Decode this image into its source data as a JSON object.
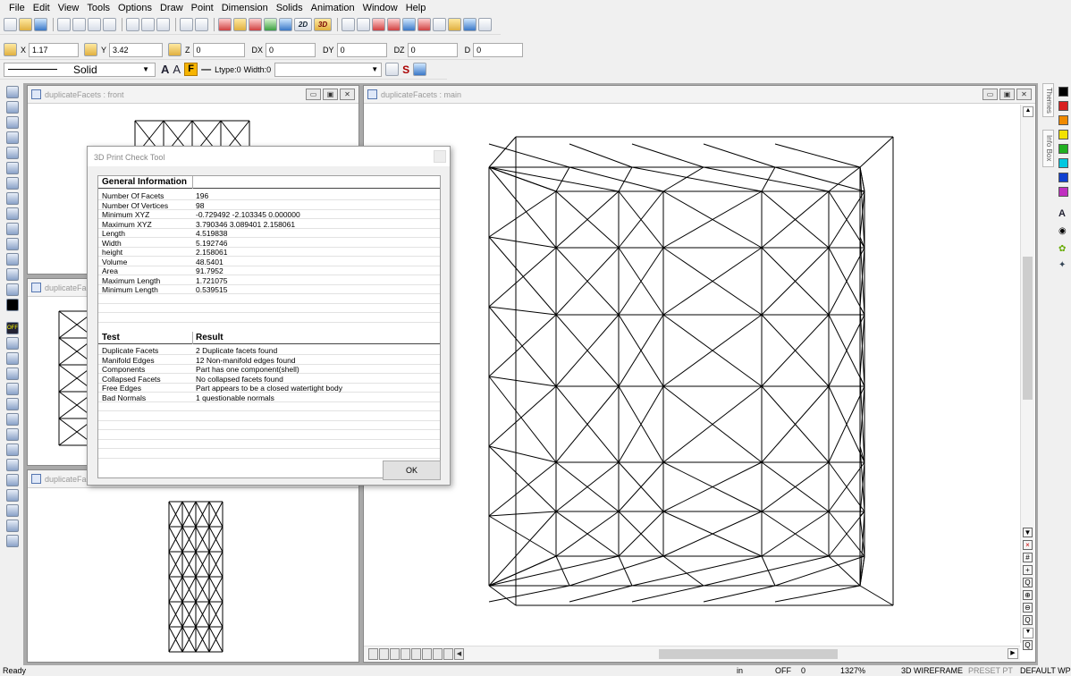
{
  "menu": [
    "File",
    "Edit",
    "View",
    "Tools",
    "Options",
    "Draw",
    "Point",
    "Dimension",
    "Solids",
    "Animation",
    "Window",
    "Help"
  ],
  "coords": {
    "x_label": "X",
    "x": "1.17",
    "y_label": "Y",
    "y": "3.42",
    "z_label": "Z",
    "z": "0",
    "dx_label": "DX",
    "dx": "0",
    "dy_label": "DY",
    "dy": "0",
    "dz_label": "DZ",
    "dz": "0",
    "d_label": "D",
    "d": "0"
  },
  "linebar": {
    "style": "Solid",
    "font_a1": "A",
    "font_a2": "A",
    "fill": "F",
    "ltype": "Ltype:0",
    "width": "Width:0",
    "s_label": "S"
  },
  "windows": {
    "front_title": "duplicateFacets : front",
    "left_mid_title": "duplicateFacets",
    "left_bottom_title": "duplicateFacets",
    "main_title": "duplicateFacets : main"
  },
  "dialog": {
    "title": "3D Print Check Tool",
    "general_header": "General Information",
    "general": [
      {
        "label": "Number Of Facets",
        "value": "196"
      },
      {
        "label": "Number Of Vertices",
        "value": "98"
      },
      {
        "label": "Minimum XYZ",
        "value": "-0.729492  -2.103345  0.000000"
      },
      {
        "label": "Maximum XYZ",
        "value": "3.790346  3.089401  2.158061"
      },
      {
        "label": "Length",
        "value": "4.519838"
      },
      {
        "label": "Width",
        "value": "5.192746"
      },
      {
        "label": "height",
        "value": "2.158061"
      },
      {
        "label": "Volume",
        "value": "48.5401"
      },
      {
        "label": "Area",
        "value": "91.7952"
      },
      {
        "label": "Maximum Length",
        "value": "1.721075"
      },
      {
        "label": "Minimum Length",
        "value": "0.539515"
      }
    ],
    "test_header": "Test",
    "result_header": "Result",
    "tests": [
      {
        "label": "Duplicate Facets",
        "value": "2 Duplicate facets found"
      },
      {
        "label": "Manifold Edges",
        "value": "12 Non-manifold edges found"
      },
      {
        "label": "Components",
        "value": "Part has one component(shell)"
      },
      {
        "label": "Collapsed Facets",
        "value": "No collapsed facets found"
      },
      {
        "label": "Free Edges",
        "value": "Part appears to be a closed watertight body"
      },
      {
        "label": "Bad Normals",
        "value": "1 questionable normals"
      }
    ],
    "ok": "OK"
  },
  "right_tabs": {
    "themes": "Themes",
    "info": "Info Box"
  },
  "swatch_colors": [
    "#000000",
    "#d81e1e",
    "#f08a00",
    "#f2e200",
    "#21b021",
    "#00c8e0",
    "#1040d0",
    "#c030c0"
  ],
  "status": {
    "ready": "Ready",
    "units": "in",
    "osnap": "OFF",
    "count": "0",
    "zoom": "1327%",
    "view": "3D WIREFRAME",
    "preset": "PRESET PT",
    "wp": "DEFAULT WP"
  }
}
